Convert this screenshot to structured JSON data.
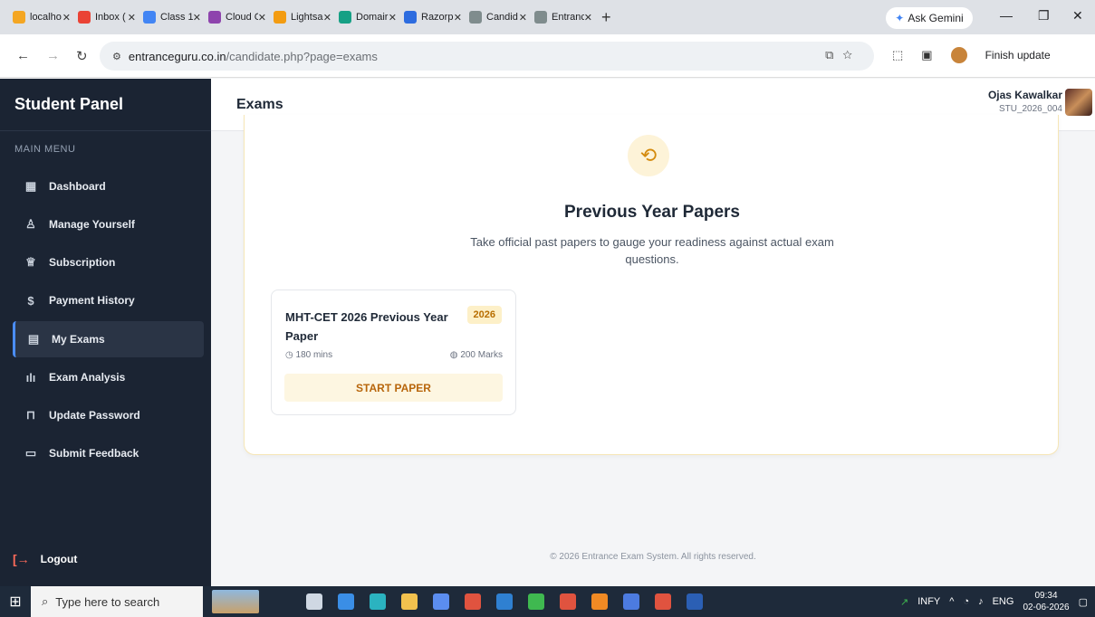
{
  "browser": {
    "tabs": [
      {
        "title": "localho",
        "color": "#f4a623"
      },
      {
        "title": "Inbox (",
        "color": "#ea4335"
      },
      {
        "title": "Class 1:",
        "color": "#4285f4"
      },
      {
        "title": "Cloud C",
        "color": "#8e44ad"
      },
      {
        "title": "Lightsa",
        "color": "#f39c12"
      },
      {
        "title": "Domair",
        "color": "#16a085"
      },
      {
        "title": "Razorp",
        "color": "#2d6cdf"
      },
      {
        "title": "Candid",
        "color": "#7f8c8d"
      },
      {
        "title": "Entranc",
        "color": "#7f8c8d"
      }
    ],
    "gemini": "Ask Gemini",
    "url_host": "entranceguru.co.in",
    "url_path": "/candidate.php?page=exams",
    "finish_update": "Finish update"
  },
  "sidebar": {
    "title": "Student Panel",
    "menu_label": "MAIN MENU",
    "items": [
      {
        "label": "Dashboard",
        "icon": "grid-icon"
      },
      {
        "label": "Manage Yourself",
        "icon": "user-icon"
      },
      {
        "label": "Subscription",
        "icon": "crown-icon"
      },
      {
        "label": "Payment History",
        "icon": "receipt-icon"
      },
      {
        "label": "My Exams",
        "icon": "clipboard-icon"
      },
      {
        "label": "Exam Analysis",
        "icon": "bar-chart-icon"
      },
      {
        "label": "Update Password",
        "icon": "lock-icon"
      },
      {
        "label": "Submit Feedback",
        "icon": "message-icon"
      }
    ],
    "logout": "Logout"
  },
  "header": {
    "title": "Exams",
    "user_name": "Ojas Kawalkar",
    "user_id": "STU_2026_004"
  },
  "section": {
    "title": "Previous Year Papers",
    "subtitle": "Take official past papers to gauge your readiness against actual exam questions."
  },
  "paper": {
    "title": "MHT-CET 2026 Previous Year Paper",
    "year": "2026",
    "duration": "180 mins",
    "marks": "200 Marks",
    "button": "START PAPER"
  },
  "footer": "© 2026 Entrance Exam System. All rights reserved.",
  "taskbar": {
    "search_placeholder": "Type here to search",
    "stock": "INFY",
    "lang": "ENG",
    "time": "09:34",
    "date": "02-06-2026"
  }
}
